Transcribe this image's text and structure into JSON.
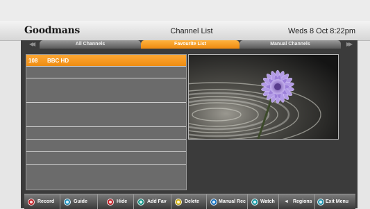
{
  "header": {
    "brand": "Goodmans",
    "title": "Channel List",
    "datetime": "Weds 8 Oct  8:22pm"
  },
  "tabs": [
    {
      "label": "All Channels",
      "active": false
    },
    {
      "label": "Favourite List",
      "active": true
    },
    {
      "label": "Manual Channels",
      "active": false
    }
  ],
  "arrows": {
    "left": "◀◀",
    "right": "▶▶"
  },
  "channels": [
    {
      "number": "108",
      "name": "BBC HD",
      "selected": true
    }
  ],
  "footer": {
    "buttons": [
      {
        "label": "Record",
        "color": "#d8232a",
        "icon": "red-button-icon"
      },
      {
        "label": "Guide",
        "color": "#2a9fd0",
        "icon": "guide-button-icon"
      },
      {
        "label": "Hide",
        "color": "#d8232a",
        "icon": "red-button-icon"
      },
      {
        "label": "Add Fav",
        "color": "#1fa99a",
        "icon": "green-button-icon"
      },
      {
        "label": "Delete",
        "color": "#e6c21a",
        "icon": "yellow-button-icon"
      },
      {
        "label": "Manual Rec",
        "color": "#1e7fd6",
        "icon": "blue-button-icon"
      },
      {
        "label": "Watch",
        "color": "#1fa9b6",
        "icon": "ok-button-icon"
      },
      {
        "label": "Regions",
        "glyph": "◄",
        "icon": "left-arrow-icon"
      },
      {
        "label": "Exit Menu",
        "color": "#2aa7c4",
        "icon": "exit-button-icon"
      }
    ]
  },
  "colors": {
    "accent": "#f39a1e",
    "background": "#3b3b3b",
    "list": "#6b6b6b"
  }
}
